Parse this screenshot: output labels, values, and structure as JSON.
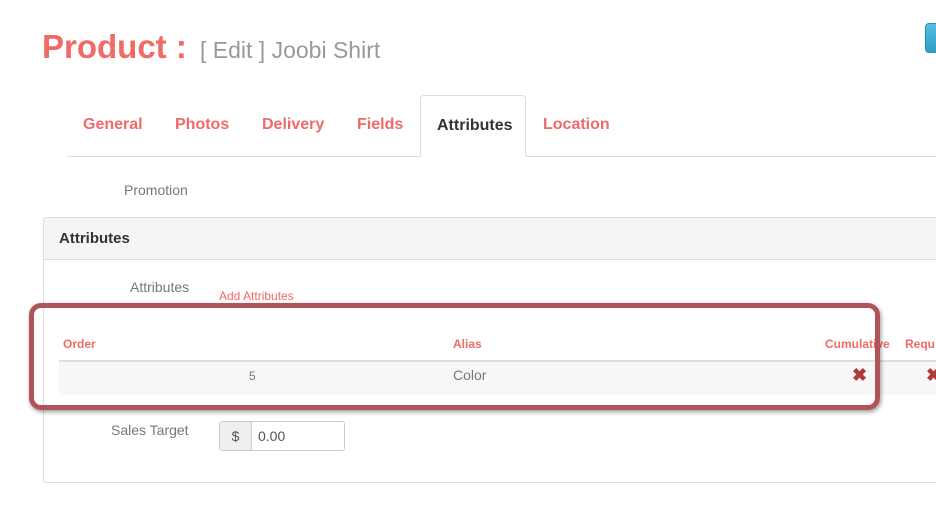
{
  "header": {
    "title": "Product :",
    "subtitle": "[ Edit ] Joobi Shirt"
  },
  "tabs": [
    {
      "label": "General"
    },
    {
      "label": "Photos"
    },
    {
      "label": "Delivery"
    },
    {
      "label": "Fields"
    },
    {
      "label": "Attributes",
      "active": true
    },
    {
      "label": "Location"
    }
  ],
  "promotion_label": "Promotion",
  "panel": {
    "title": "Attributes",
    "attributes_label": "Attributes",
    "add_link": "Add Attributes"
  },
  "table": {
    "headers": [
      "Order",
      "Alias",
      "Cumulative",
      "Requ"
    ],
    "rows": [
      {
        "order": "5",
        "alias": "Color",
        "cumulative": "false",
        "required": "false"
      }
    ]
  },
  "sales_target": {
    "label": "Sales Target",
    "currency": "$",
    "value": "0.00"
  },
  "icons": {
    "remove": "times-icon"
  },
  "colors": {
    "accent": "#f06a66",
    "highlight": "#b0545c",
    "x": "#b03a3a"
  }
}
